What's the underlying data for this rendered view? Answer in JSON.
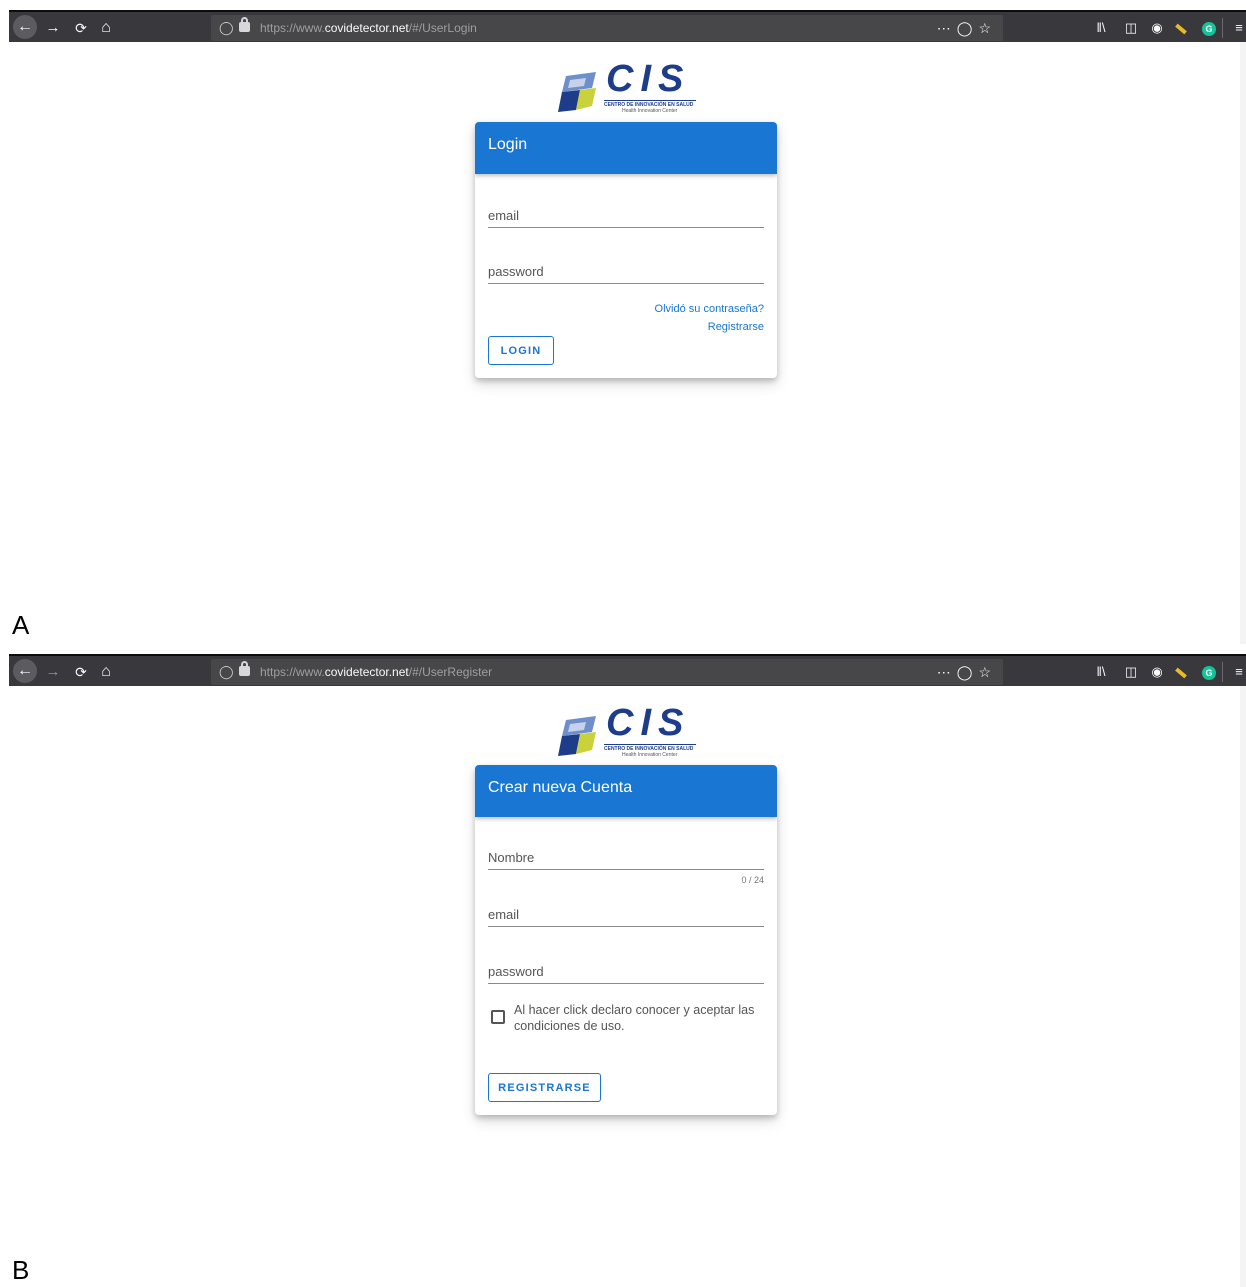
{
  "panels": [
    {
      "label": "A",
      "url": {
        "prefix": "https://www.",
        "domain": "covidetector.net",
        "path": "/#/UserLogin"
      },
      "card": {
        "title": "Login",
        "email_placeholder": "email",
        "password_placeholder": "password",
        "forgot_link": "Olvidó su contraseña?",
        "register_link": "Registrarse",
        "submit_label": "LOGIN"
      }
    },
    {
      "label": "B",
      "url": {
        "prefix": "https://www.",
        "domain": "covidetector.net",
        "path": "/#/UserRegister"
      },
      "card": {
        "title": "Crear nueva Cuenta",
        "name_placeholder": "Nombre",
        "name_counter": "0 / 24",
        "email_placeholder": "email",
        "password_placeholder": "password",
        "terms_text": "Al hacer click declaro conocer y aceptar las condiciones de uso.",
        "terms_checked": false,
        "submit_label": "REGISTRARSE"
      }
    }
  ],
  "logo": {
    "name": "CIS",
    "subtitle": "CENTRO DE INNOVACIÓN EN SALUD",
    "subtitle_en": "Health Innovation Center"
  },
  "icons": {
    "back": "back-arrow-icon",
    "forward": "forward-arrow-icon",
    "reload": "reload-icon",
    "home": "home-icon",
    "page_actions": "ellipsis-icon",
    "pocket": "pocket-icon",
    "bookmark": "star-icon",
    "library": "library-icon",
    "sidebar": "sidebar-icon",
    "account": "account-icon",
    "extension": "pencil-icon",
    "grammarly": "grammarly-icon",
    "menu": "hamburger-menu-icon"
  },
  "colors": {
    "primary": "#1976d2",
    "toolbar": "#38383d",
    "logo_blue": "#1d3c8a"
  }
}
